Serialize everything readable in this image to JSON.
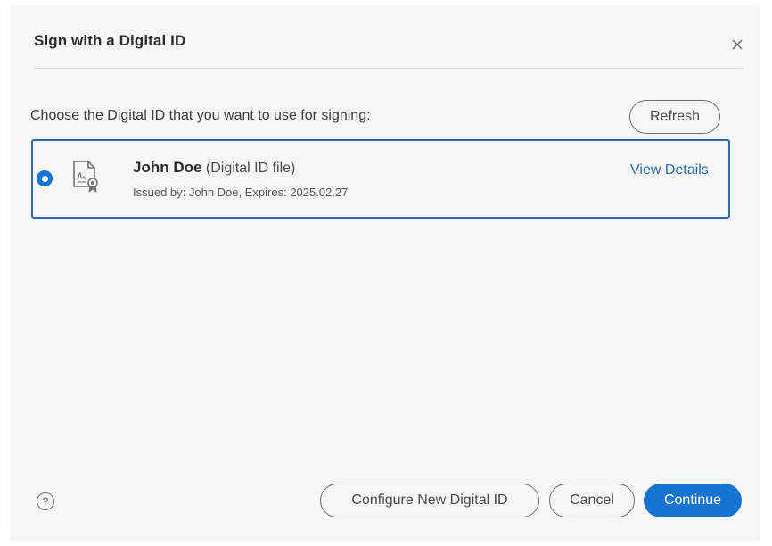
{
  "dialog": {
    "title": "Sign with a Digital ID",
    "close_icon": "close-icon",
    "instruction": "Choose the Digital ID that you want to use for signing:",
    "refresh_label": "Refresh"
  },
  "digital_ids": [
    {
      "selected": true,
      "icon": "certificate-file-icon",
      "name": "John Doe",
      "type": "(Digital ID file)",
      "issued": "Issued by: John Doe, Expires: 2025.02.27",
      "view_details_label": "View Details"
    }
  ],
  "footer": {
    "help_icon": "help-icon",
    "help_glyph": "?",
    "configure_label": "Configure New Digital ID",
    "cancel_label": "Cancel",
    "continue_label": "Continue"
  },
  "colors": {
    "accent": "#1673d2",
    "selection_border": "#2e6aa8",
    "background": "#f6f6f6"
  }
}
